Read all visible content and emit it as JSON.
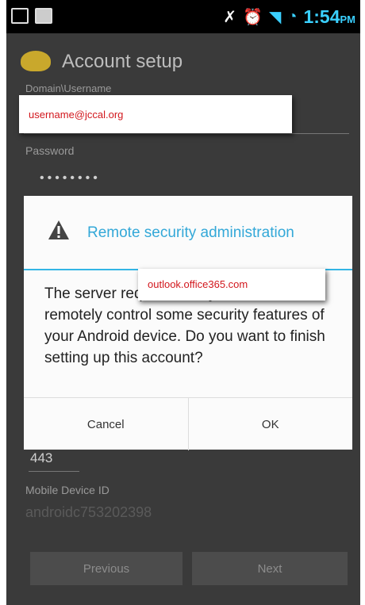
{
  "status_bar": {
    "time": "1:54",
    "ampm": "PM",
    "icons": [
      "image-icon",
      "gmail-icon",
      "no-signal-icon",
      "alarm-icon",
      "wifi-icon",
      "signal-icon",
      "sync-icon"
    ]
  },
  "action_bar": {
    "title": "Account setup"
  },
  "form": {
    "domain_label": "Domain\\Username",
    "username_value": "username@jccal.org",
    "password_label": "Password",
    "password_mask": "••••••••",
    "port_value": "443",
    "device_id_label": "Mobile Device ID",
    "device_id_value": "androidc753202398"
  },
  "dialog": {
    "title": "Remote security administration",
    "body": "The server                         requires that you allow it to remotely control some security features of your Android device. Do you want to finish setting up this account?",
    "server_callout": "outlook.office365.com",
    "cancel_label": "Cancel",
    "ok_label": "OK"
  },
  "nav": {
    "previous_label": "Previous",
    "next_label": "Next"
  },
  "colors": {
    "accent": "#33b5e5",
    "callout_text": "#d2171d"
  }
}
